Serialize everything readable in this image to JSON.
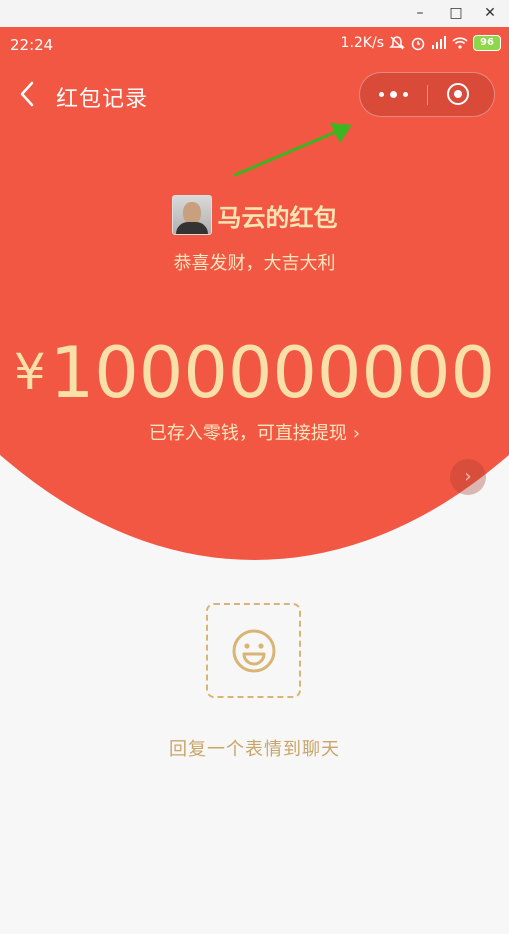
{
  "window": {
    "minimize": "–",
    "maximize": "□",
    "close": "✕"
  },
  "status_bar": {
    "time": "22:24",
    "speed": "1.2K/s",
    "battery": "96"
  },
  "header": {
    "title": "红包记录"
  },
  "packet": {
    "sender": "马云的红包",
    "greeting": "恭喜发财，大吉大利",
    "currency": "¥",
    "amount": "1000000000",
    "saved_text": "已存入零钱，可直接提现",
    "saved_chevron": "›"
  },
  "next_label": "›",
  "reply_text": "回复一个表情到聊天",
  "colors": {
    "red": "#f25743",
    "gold": "#f9dfa8",
    "reply": "#c9a56a",
    "arrow": "#3cb521"
  }
}
